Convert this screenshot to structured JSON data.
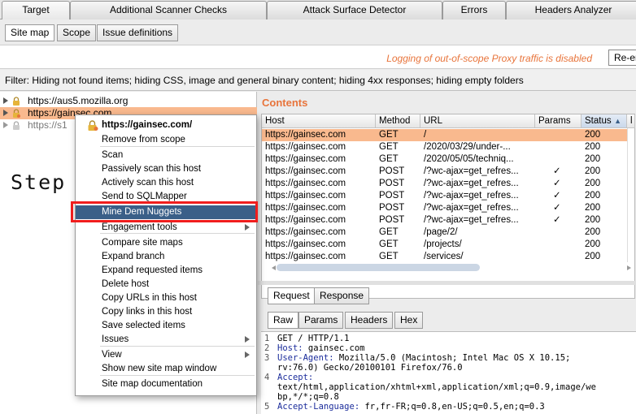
{
  "top_tabs": [
    "Target",
    "Additional Scanner Checks",
    "Attack Surface Detector",
    "Errors",
    "Headers Analyzer"
  ],
  "sub_tabs": [
    "Site map",
    "Scope",
    "Issue definitions"
  ],
  "logging_text": "Logging of out-of-scope Proxy traffic is disabled",
  "reenable_label": "Re-en",
  "filter_text": "Filter: Hiding not found items;  hiding CSS, image and general binary content;  hiding 4xx responses;  hiding empty folders",
  "tree": {
    "items": [
      "https://aus5.mozilla.org",
      "https://gainsec.com",
      "https://s1"
    ]
  },
  "step_label": "Step 5",
  "context_menu": {
    "header": "https://gainsec.com/",
    "items": [
      "Remove from scope",
      "Scan",
      "Passively scan this host",
      "Actively scan this host",
      "Send to SQLMapper",
      "Mine Dem Nuggets",
      "Engagement tools",
      "Compare site maps",
      "Expand branch",
      "Expand requested items",
      "Delete host",
      "Copy URLs in this host",
      "Copy links in this host",
      "Save selected items",
      "Issues",
      "View",
      "Show new site map window",
      "Site map documentation"
    ],
    "highlighted": "Mine Dem Nuggets"
  },
  "contents": {
    "title": "Contents",
    "columns": [
      "Host",
      "Method",
      "URL",
      "Params",
      "Status",
      "▲",
      "l"
    ],
    "rows": [
      {
        "host": "https://gainsec.com",
        "method": "GET",
        "url": "/",
        "params": "",
        "status": "200"
      },
      {
        "host": "https://gainsec.com",
        "method": "GET",
        "url": "/2020/03/29/under-...",
        "params": "",
        "status": "200"
      },
      {
        "host": "https://gainsec.com",
        "method": "GET",
        "url": "/2020/05/05/techniq...",
        "params": "",
        "status": "200"
      },
      {
        "host": "https://gainsec.com",
        "method": "POST",
        "url": "/?wc-ajax=get_refres...",
        "params": "✓",
        "status": "200"
      },
      {
        "host": "https://gainsec.com",
        "method": "POST",
        "url": "/?wc-ajax=get_refres...",
        "params": "✓",
        "status": "200"
      },
      {
        "host": "https://gainsec.com",
        "method": "POST",
        "url": "/?wc-ajax=get_refres...",
        "params": "✓",
        "status": "200"
      },
      {
        "host": "https://gainsec.com",
        "method": "POST",
        "url": "/?wc-ajax=get_refres...",
        "params": "✓",
        "status": "200"
      },
      {
        "host": "https://gainsec.com",
        "method": "POST",
        "url": "/?wc-ajax=get_refres...",
        "params": "✓",
        "status": "200"
      },
      {
        "host": "https://gainsec.com",
        "method": "GET",
        "url": "/page/2/",
        "params": "",
        "status": "200"
      },
      {
        "host": "https://gainsec.com",
        "method": "GET",
        "url": "/projects/",
        "params": "",
        "status": "200"
      },
      {
        "host": "https://gainsec.com",
        "method": "GET",
        "url": "/services/",
        "params": "",
        "status": "200"
      }
    ]
  },
  "req_tabs": [
    "Request",
    "Response"
  ],
  "view_tabs": [
    "Raw",
    "Params",
    "Headers",
    "Hex"
  ],
  "request_lines": [
    {
      "n": "1",
      "key": "",
      "text": "GET / HTTP/1.1"
    },
    {
      "n": "2",
      "key": "Host:",
      "text": " gainsec.com"
    },
    {
      "n": "3",
      "key": "User-Agent:",
      "text": " Mozilla/5.0 (Macintosh; Intel Mac OS X 10.15;"
    },
    {
      "n": "",
      "key": "",
      "text": "rv:76.0) Gecko/20100101 Firefox/76.0"
    },
    {
      "n": "4",
      "key": "Accept:",
      "text": ""
    },
    {
      "n": "",
      "key": "",
      "text": "text/html,application/xhtml+xml,application/xml;q=0.9,image/we"
    },
    {
      "n": "",
      "key": "",
      "text": "bp,*/*;q=0.8"
    },
    {
      "n": "5",
      "key": "Accept-Language:",
      "text": " fr,fr-FR;q=0.8,en-US;q=0.5,en;q=0.3"
    }
  ],
  "colors": {
    "accent_orange": "#e8743b",
    "selection": "#f9b98e",
    "menu_highlight": "#3a5f88",
    "red_box": "#f01d1d"
  }
}
